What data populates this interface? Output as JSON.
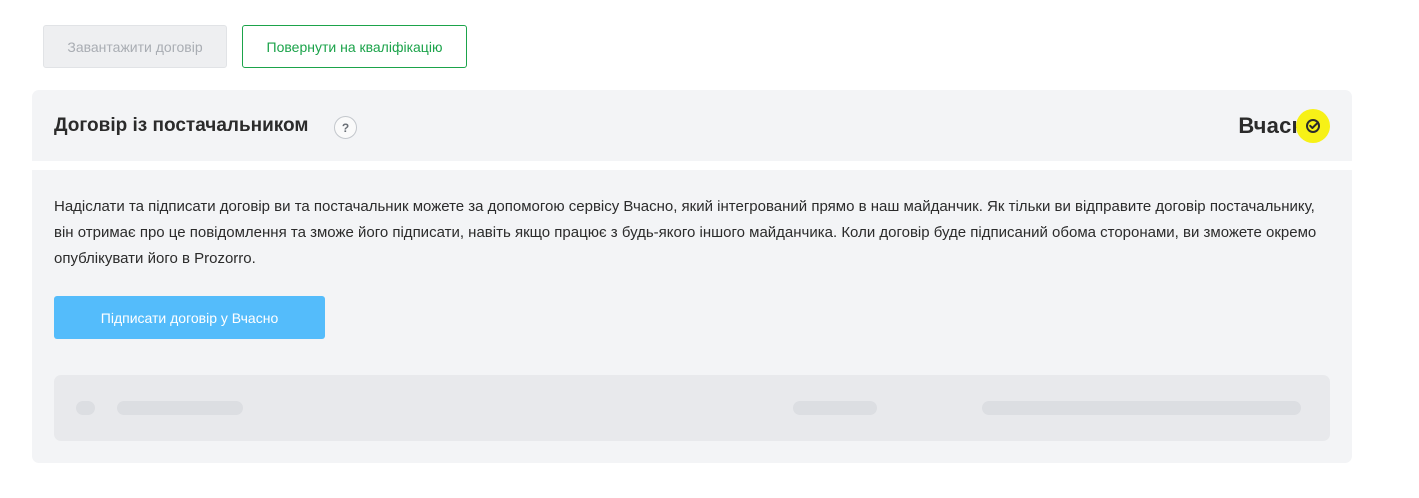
{
  "toolbar": {
    "upload_label": "Завантажити договір",
    "return_label": "Повернути на кваліфікацію"
  },
  "panel": {
    "title": "Договір із постачальником",
    "help_symbol": "?",
    "logo_text": "Вчасн",
    "description": "Надіслати та підписати договір ви та постачальник можете за допомогою сервісу Вчасно, який інтегрований прямо в наш майданчик. Як тільки ви відправите договір постачальнику, він отримає про це повідомлення та зможе його підписати, навіть якщо працює з будь-якого іншого майданчика. Коли договір буде підписаний обома сторонами, ви зможете окремо опублікувати його в Prozorro.",
    "sign_button_label": "Підписати договір у Вчасно"
  },
  "icons": {
    "help": "question-icon",
    "logo_mark": "check-circle-icon"
  },
  "colors": {
    "green_accent": "#1ba34a",
    "primary_blue": "#54bcfb",
    "logo_yellow": "#f7f117"
  }
}
